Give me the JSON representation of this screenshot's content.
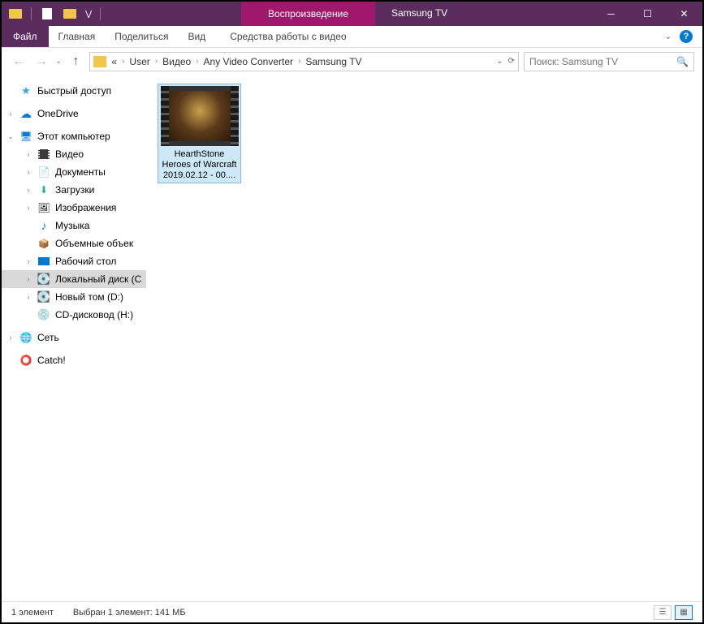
{
  "titlebar": {
    "context_label": "Воспроизведение",
    "title": "Samsung TV"
  },
  "ribbon": {
    "file": "Файл",
    "tabs": [
      "Главная",
      "Поделиться",
      "Вид"
    ],
    "context_tab": "Средства работы с видео"
  },
  "breadcrumb": {
    "prefix": "«",
    "segments": [
      "User",
      "Видео",
      "Any Video Converter",
      "Samsung TV"
    ]
  },
  "search": {
    "placeholder": "Поиск: Samsung TV"
  },
  "tree": {
    "quick": "Быстрый доступ",
    "onedrive": "OneDrive",
    "pc": "Этот компьютер",
    "video": "Видео",
    "docs": "Документы",
    "downloads": "Загрузки",
    "images": "Изображения",
    "music": "Музыка",
    "volumes": "Объемные объек",
    "desktop": "Рабочий стол",
    "local": "Локальный диск (C",
    "newvol": "Новый том (D:)",
    "cd": "CD-дисковод (H:)",
    "network": "Сеть",
    "catch": "Catch!"
  },
  "file": {
    "name": "HearthStone Heroes of Warcraft  2019.02.12 - 00...."
  },
  "status": {
    "count": "1 элемент",
    "selected": "Выбран 1 элемент: 141 МБ"
  }
}
